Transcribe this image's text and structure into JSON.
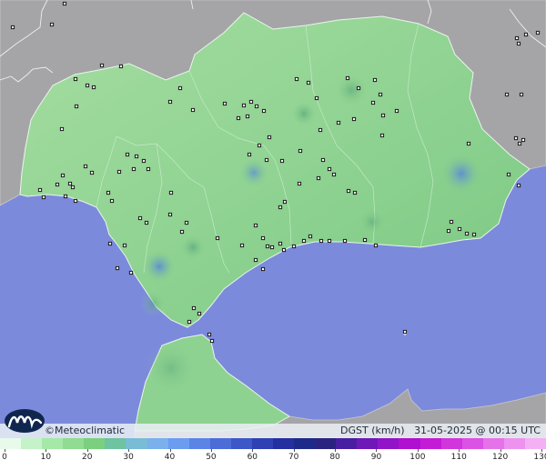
{
  "map": {
    "brand": "©Meteoclimatic",
    "info": {
      "variable": "DGST (km/h)",
      "datetime": "31-05-2025 @ 00:15 UTC"
    },
    "colors": {
      "sea": "#7c8adc",
      "neighbor_land": "#a5a5a8",
      "region_low": "#9fdc9a",
      "region_mid": "#86cf88",
      "region_high": "#66b874",
      "gust_spot": "#5a8fd2",
      "station_marker": "#1a1a1a"
    },
    "legend": {
      "ticks": [
        "0",
        "10",
        "20",
        "30",
        "40",
        "50",
        "60",
        "70",
        "80",
        "90",
        "100",
        "110",
        "120",
        "130"
      ],
      "colors": [
        "#e8fbea",
        "#c5f2c8",
        "#a5e9a8",
        "#8fdc92",
        "#7ad07e",
        "#6ec3a0",
        "#78bcd6",
        "#7ab0ec",
        "#6c9cf0",
        "#5b84e6",
        "#4c6cd8",
        "#3d56c8",
        "#2f40b4",
        "#2430a0",
        "#1e2a8a",
        "#2a2480",
        "#4a1ea0",
        "#6e18b8",
        "#9214c8",
        "#b010d0",
        "#c41cd6",
        "#d036dc",
        "#dc52e4",
        "#e672ea",
        "#ee92f0",
        "#f4b0f4"
      ]
    },
    "stations": [
      [
        14,
        30
      ],
      [
        57,
        27
      ],
      [
        71,
        4
      ],
      [
        112,
        72
      ],
      [
        133,
        73
      ],
      [
        83,
        87
      ],
      [
        96,
        94
      ],
      [
        103,
        96
      ],
      [
        198,
        97
      ],
      [
        187,
        112
      ],
      [
        212,
        121
      ],
      [
        247,
        114
      ],
      [
        262,
        130
      ],
      [
        268,
        116
      ],
      [
        276,
        112
      ],
      [
        282,
        117
      ],
      [
        290,
        122
      ],
      [
        272,
        128
      ],
      [
        326,
        87
      ],
      [
        339,
        91
      ],
      [
        348,
        108
      ],
      [
        382,
        86
      ],
      [
        394,
        97
      ],
      [
        412,
        88
      ],
      [
        418,
        104
      ],
      [
        410,
        113
      ],
      [
        421,
        127
      ],
      [
        436,
        122
      ],
      [
        372,
        135
      ],
      [
        389,
        131
      ],
      [
        352,
        143
      ],
      [
        420,
        149
      ],
      [
        296,
        151
      ],
      [
        285,
        160
      ],
      [
        274,
        170
      ],
      [
        293,
        176
      ],
      [
        310,
        177
      ],
      [
        330,
        166
      ],
      [
        355,
        176
      ],
      [
        362,
        186
      ],
      [
        367,
        192
      ],
      [
        329,
        202
      ],
      [
        350,
        196
      ],
      [
        383,
        210
      ],
      [
        390,
        212
      ],
      [
        313,
        222
      ],
      [
        308,
        228
      ],
      [
        188,
        212
      ],
      [
        187,
        236
      ],
      [
        200,
        255
      ],
      [
        140,
        170
      ],
      [
        150,
        172
      ],
      [
        158,
        177
      ],
      [
        163,
        186
      ],
      [
        147,
        186
      ],
      [
        131,
        189
      ],
      [
        94,
        183
      ],
      [
        101,
        190
      ],
      [
        69,
        193
      ],
      [
        77,
        202
      ],
      [
        63,
        203
      ],
      [
        80,
        206
      ],
      [
        72,
        216
      ],
      [
        44,
        209
      ],
      [
        48,
        217
      ],
      [
        83,
        221
      ],
      [
        119,
        212
      ],
      [
        123,
        221
      ],
      [
        68,
        142
      ],
      [
        84,
        117
      ],
      [
        154,
        240
      ],
      [
        161,
        245
      ],
      [
        205,
        245
      ],
      [
        239,
        262
      ],
      [
        266,
        270
      ],
      [
        281,
        248
      ],
      [
        289,
        262
      ],
      [
        294,
        271
      ],
      [
        299,
        272
      ],
      [
        308,
        268
      ],
      [
        323,
        271
      ],
      [
        334,
        265
      ],
      [
        341,
        260
      ],
      [
        353,
        265
      ],
      [
        362,
        265
      ],
      [
        379,
        265
      ],
      [
        401,
        264
      ],
      [
        413,
        270
      ],
      [
        281,
        286
      ],
      [
        289,
        296
      ],
      [
        312,
        275
      ],
      [
        496,
        244
      ],
      [
        505,
        252
      ],
      [
        513,
        257
      ],
      [
        521,
        258
      ],
      [
        493,
        254
      ],
      [
        137,
        270
      ],
      [
        121,
        268
      ],
      [
        129,
        295
      ],
      [
        144,
        300
      ],
      [
        213,
        339
      ],
      [
        219,
        345
      ],
      [
        208,
        354
      ],
      [
        230,
        368
      ],
      [
        233,
        375
      ],
      [
        445,
        365
      ],
      [
        568,
        42
      ],
      [
        578,
        38
      ],
      [
        570,
        48
      ],
      [
        591,
        36
      ],
      [
        557,
        104
      ],
      [
        573,
        104
      ],
      [
        567,
        152
      ],
      [
        571,
        158
      ],
      [
        575,
        154
      ],
      [
        559,
        192
      ],
      [
        570,
        204
      ],
      [
        515,
        158
      ]
    ]
  }
}
